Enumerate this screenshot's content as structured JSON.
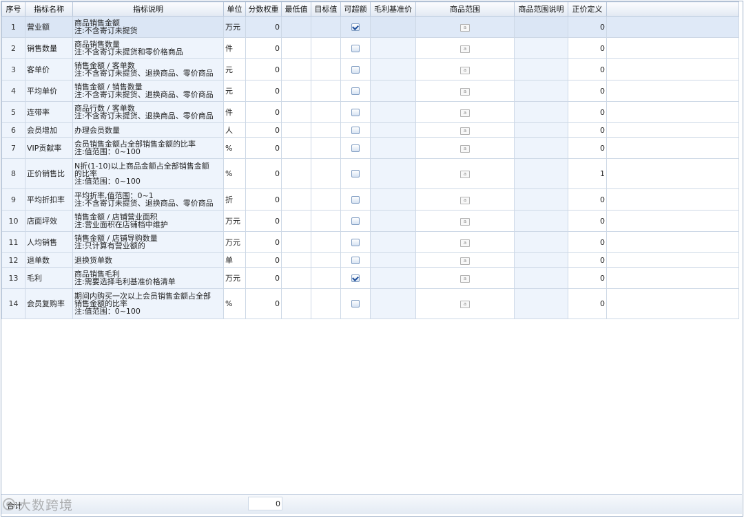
{
  "columns": {
    "idx": "序号",
    "name": "指标名称",
    "desc": "指标说明",
    "unit": "单位",
    "weight": "分数权重",
    "min": "最低值",
    "target": "目标值",
    "exceed": "可超额",
    "base": "毛利基准价",
    "scope": "商品范围",
    "scope_desc": "商品范围说明",
    "fullprice": "正价定义"
  },
  "rows": [
    {
      "idx": "1",
      "name": "营业额",
      "desc": [
        "商品销售金额",
        "注:不含寄订未提货"
      ],
      "unit": "万元",
      "weight": "0",
      "exceed": true,
      "fullprice": "0",
      "selected": true
    },
    {
      "idx": "2",
      "name": "销售数量",
      "desc": [
        "商品销售数量",
        "注:不含寄订未提货和零价格商品"
      ],
      "unit": "件",
      "weight": "0",
      "exceed": false,
      "fullprice": "0"
    },
    {
      "idx": "3",
      "name": "客单价",
      "desc": [
        "销售金额 / 客单数",
        "注:不含寄订未提货、退换商品、零价商品"
      ],
      "unit": "元",
      "weight": "0",
      "exceed": false,
      "fullprice": "0"
    },
    {
      "idx": "4",
      "name": "平均单价",
      "desc": [
        "销售金额 / 销售数量",
        "注:不含寄订未提货、退换商品、零价商品"
      ],
      "unit": "元",
      "weight": "0",
      "exceed": false,
      "fullprice": "0"
    },
    {
      "idx": "5",
      "name": "连带率",
      "desc": [
        "商品行数 / 客单数",
        "注:不含寄订未提货、退换商品、零价商品"
      ],
      "unit": "件",
      "weight": "0",
      "exceed": false,
      "fullprice": "0"
    },
    {
      "idx": "6",
      "name": "会员增加",
      "desc": [
        "办理会员数量"
      ],
      "unit": "人",
      "weight": "0",
      "exceed": false,
      "fullprice": "0"
    },
    {
      "idx": "7",
      "name": "VIP贡献率",
      "desc": [
        "会员销售金额占全部销售金额的比率",
        "注:值范围：0~100"
      ],
      "unit": "%",
      "weight": "0",
      "exceed": false,
      "fullprice": "0"
    },
    {
      "idx": "8",
      "name": "正价销售比",
      "desc": [
        "N折(1-10)以上商品金额占全部销售金额",
        "的比率",
        "注:值范围：0~100"
      ],
      "unit": "%",
      "weight": "0",
      "exceed": false,
      "fullprice": "1"
    },
    {
      "idx": "9",
      "name": "平均折扣率",
      "desc": [
        "平均折率,值范围：0~1",
        "注:不含寄订未提货、退换商品、零价商品"
      ],
      "unit": "折",
      "weight": "0",
      "exceed": false,
      "fullprice": "0"
    },
    {
      "idx": "10",
      "name": "店面坪效",
      "desc": [
        "销售金额 / 店铺营业面积",
        "注:营业面积在店铺档中维护"
      ],
      "unit": "万元",
      "weight": "0",
      "exceed": false,
      "fullprice": "0"
    },
    {
      "idx": "11",
      "name": "人均销售",
      "desc": [
        "销售金额 / 店铺导购数量",
        "注:只计算有营业额的"
      ],
      "unit": "万元",
      "weight": "0",
      "exceed": false,
      "fullprice": "0"
    },
    {
      "idx": "12",
      "name": "退单数",
      "desc": [
        "退换货单数"
      ],
      "unit": "单",
      "weight": "0",
      "exceed": false,
      "fullprice": "0"
    },
    {
      "idx": "13",
      "name": "毛利",
      "desc": [
        "商品销售毛利",
        "注:需要选择毛利基准价格清单"
      ],
      "unit": "万元",
      "weight": "0",
      "exceed": true,
      "fullprice": "0"
    },
    {
      "idx": "14",
      "name": "会员复购率",
      "desc": [
        "期间内购买一次以上会员销售金额占全部",
        "销售金额的比率",
        "注:值范围：0~100"
      ],
      "unit": "%",
      "weight": "0",
      "exceed": false,
      "fullprice": "0"
    }
  ],
  "scope_icon": "a",
  "footer": {
    "total_label": "合计",
    "total_weight": "0"
  },
  "watermark": "大数跨境"
}
